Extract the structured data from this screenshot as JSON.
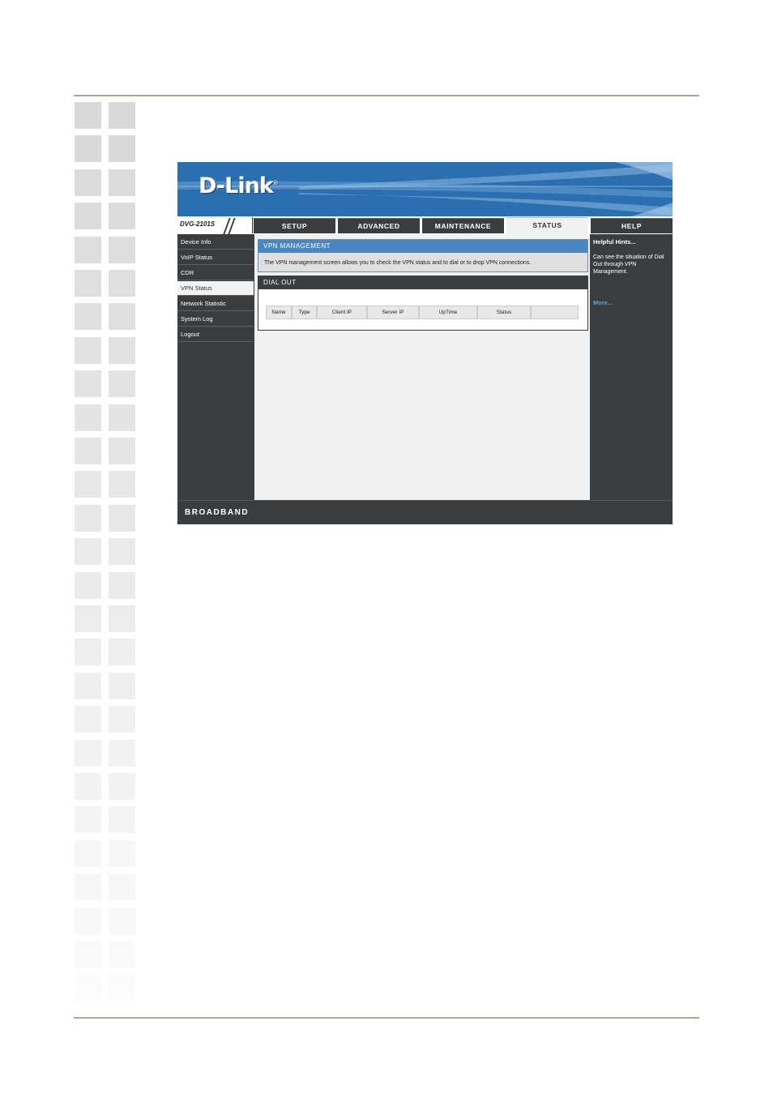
{
  "brand": {
    "logo_text": "D-Link",
    "model": "DVG-2101S",
    "footer": "BROADBAND"
  },
  "tabs": [
    {
      "label": "SETUP"
    },
    {
      "label": "ADVANCED"
    },
    {
      "label": "MAINTENANCE"
    },
    {
      "label": "STATUS",
      "active": true
    },
    {
      "label": "HELP"
    }
  ],
  "sidebar": {
    "items": [
      {
        "label": "Device Info"
      },
      {
        "label": "VoIP Status"
      },
      {
        "label": "CDR"
      },
      {
        "label": "VPN Status",
        "active": true
      },
      {
        "label": "Network Statistic"
      },
      {
        "label": "System Log"
      },
      {
        "label": "Logout"
      }
    ]
  },
  "vpn": {
    "title": "VPN MANAGEMENT",
    "description": "The VPN management screen allows you to check the VPN status and to dial or to drop VPN connections."
  },
  "dialout": {
    "title": "DIAL OUT",
    "columns": [
      "Name",
      "Type",
      "Client IP",
      "Server IP",
      "UpTime",
      "Status",
      ""
    ]
  },
  "hints": {
    "title": "Helpful Hints...",
    "text": "Can see the situation of Dial Out through VPN Management.",
    "more": "More..."
  },
  "colors": {
    "banner_blue": "#2c6fb0",
    "panel_dark": "#3a3d40",
    "section_blue": "#4a86c1",
    "link_blue": "#5aa3e8"
  }
}
